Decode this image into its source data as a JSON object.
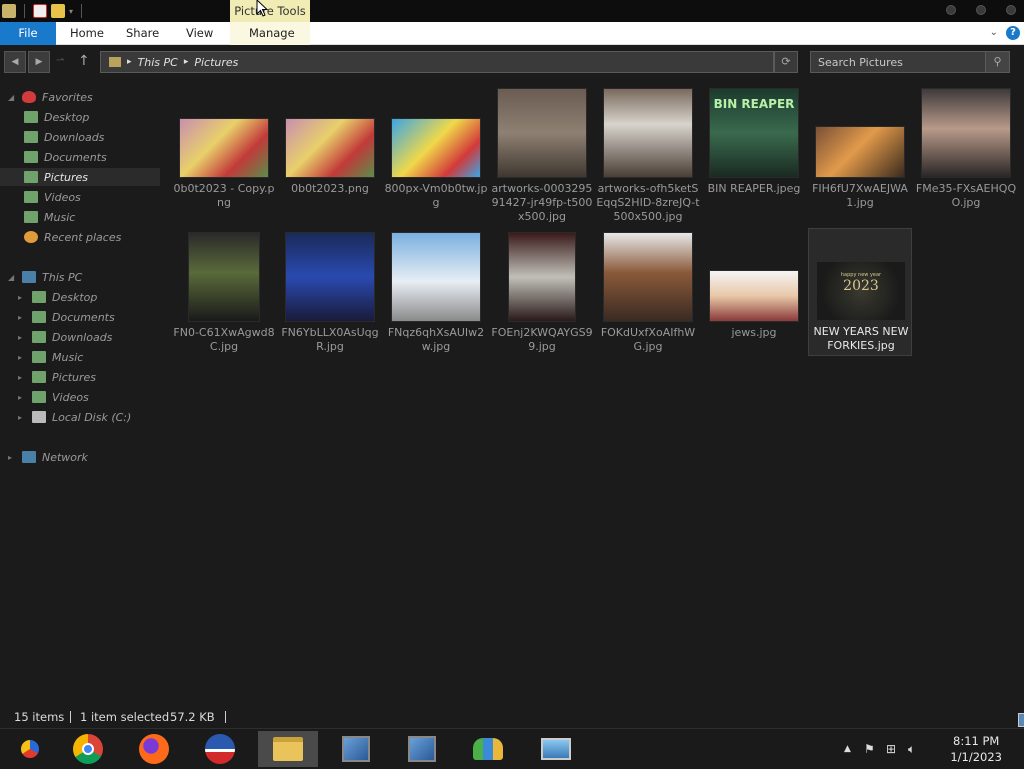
{
  "titlebar": {
    "context_tab": "Picture Tools"
  },
  "ribbon": {
    "tabs": [
      "File",
      "Home",
      "Share",
      "View",
      "Manage"
    ]
  },
  "address": {
    "crumbs": [
      "This PC",
      "Pictures"
    ],
    "separator": "▸"
  },
  "search": {
    "placeholder": "Search Pictures"
  },
  "nav": {
    "favorites": "Favorites",
    "fav_items": [
      "Desktop",
      "Downloads",
      "Documents",
      "Pictures",
      "Recent places"
    ],
    "thispc": "This PC",
    "pc_items": [
      "Desktop",
      "Documents",
      "Downloads",
      "Music",
      "Pictures",
      "Videos",
      "Local Disk (C:)"
    ],
    "network": "Network"
  },
  "files": [
    {
      "name": "0b0t2023 - Copy.png"
    },
    {
      "name": "0b0t2023.png"
    },
    {
      "name": "800px-Vm0b0tw.jpg"
    },
    {
      "name": "artworks-000329591427-jr49fp-t500x500.jpg"
    },
    {
      "name": "artworks-ofh5ketSEqqS2HID-8zreJQ-t500x500.jpg"
    },
    {
      "name": "BIN REAPER.jpeg"
    },
    {
      "name": "FIH6fU7XwAEJWA1.jpg"
    },
    {
      "name": "FMe35-FXsAEHQQO.jpg"
    },
    {
      "name": "FN0-C61XwAgwd8C.jpg"
    },
    {
      "name": "FN6YbLLX0AsUqgR.jpg"
    },
    {
      "name": "FNqz6qhXsAUIw2w.jpg"
    },
    {
      "name": "FOEnj2KWQAYGS99.jpg"
    },
    {
      "name": "FOKdUxfXoAIfhWG.jpg"
    },
    {
      "name": "jews.jpg"
    },
    {
      "name": "NEW YEARS NEW FORKIES.jpg"
    }
  ],
  "thumb_text": {
    "bin_reaper": "BIN REAPER",
    "ny_year": "2023",
    "ny_small": "happy new year"
  },
  "status": {
    "count": "15 items",
    "selected": "1 item selected",
    "size": "57.2 KB"
  },
  "clock": {
    "time": "8:11 PM",
    "date": "1/1/2023"
  },
  "colors": {
    "accent": "#1979ca",
    "context": "#f1ecb4",
    "background": "#1b1b1b"
  }
}
